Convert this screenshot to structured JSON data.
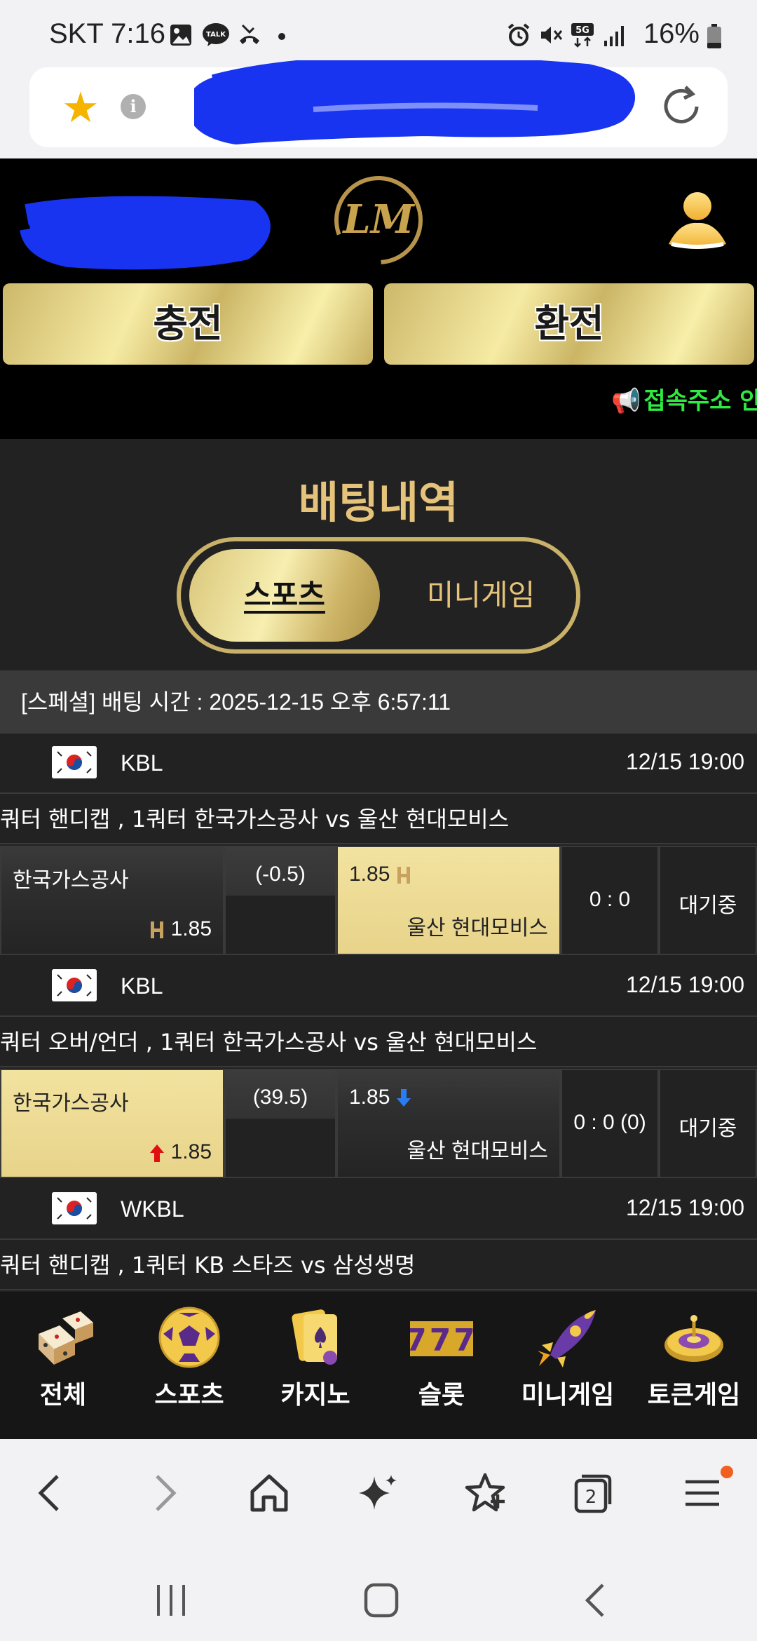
{
  "status_bar": {
    "carrier_time": "SKT 7:16",
    "talk_badge": "TALK",
    "network": "5G",
    "battery": "16%"
  },
  "site": {
    "logo_text": "LM"
  },
  "header": {
    "deposit_label": "충전",
    "withdraw_label": "환전",
    "notice_text": "접속주소 안"
  },
  "main": {
    "title": "배팅내역",
    "tabs": [
      {
        "label": "스포츠"
      },
      {
        "label": "미니게임"
      }
    ],
    "bet_header": "[스페셜] 배팅 시간 : 2025-12-15 오후 6:57:11"
  },
  "bets": [
    {
      "league": "KBL",
      "time": "12/15 19:00",
      "market": "쿼터 핸디캡 , 1쿼터 한국가스공사  vs  울산 현대모비스",
      "home": "한국가스공사",
      "home_odds": "1.85",
      "line": "(-0.5)",
      "away_odds": "1.85",
      "away": "울산 현대모비스",
      "score": "0 : 0",
      "status": "대기중"
    },
    {
      "league": "KBL",
      "time": "12/15 19:00",
      "market": "쿼터 오버/언더 , 1쿼터 한국가스공사  vs  울산 현대모비스",
      "home": "한국가스공사",
      "home_odds": "1.85",
      "line": "(39.5)",
      "away_odds": "1.85",
      "away": "울산 현대모비스",
      "score": "0 : 0 (0)",
      "status": "대기중"
    },
    {
      "league": "WKBL",
      "time": "12/15 19:00",
      "market": "쿼터 핸디캡 , 1쿼터 KB 스타즈  vs  삼성생명"
    }
  ],
  "categories": [
    {
      "label": "전체",
      "icon": "dice-icon"
    },
    {
      "label": "스포츠",
      "icon": "soccer-ball-icon"
    },
    {
      "label": "카지노",
      "icon": "playing-cards-icon"
    },
    {
      "label": "슬롯",
      "icon": "slot-777-icon"
    },
    {
      "label": "미니게임",
      "icon": "rocket-icon"
    },
    {
      "label": "토큰게임",
      "icon": "roulette-icon"
    }
  ],
  "slot_text": "777",
  "browser": {
    "tab_count": "2"
  },
  "colors": {
    "gold": "#e6c37b",
    "notice_green": "#2eea43",
    "selected_odds": "#e8d38a"
  }
}
